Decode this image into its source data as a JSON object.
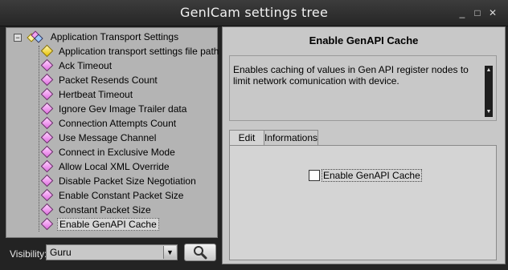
{
  "window": {
    "title": "GenICam settings tree",
    "controls": [
      "_",
      "□",
      "✕"
    ]
  },
  "tree": {
    "root": "Application Transport Settings",
    "items": [
      {
        "label": "Application transport settings file path",
        "icon": "yellow"
      },
      {
        "label": "Ack Timeout",
        "icon": "pink"
      },
      {
        "label": "Packet Resends Count",
        "icon": "pink"
      },
      {
        "label": "Hertbeat Timeout",
        "icon": "pink"
      },
      {
        "label": "Ignore Gev Image Trailer data",
        "icon": "pink"
      },
      {
        "label": "Connection Attempts Count",
        "icon": "pink"
      },
      {
        "label": "Use Message Channel",
        "icon": "pink"
      },
      {
        "label": "Connect in Exclusive Mode",
        "icon": "pink"
      },
      {
        "label": "Allow Local XML Override",
        "icon": "pink"
      },
      {
        "label": "Disable Packet Size Negotiation",
        "icon": "pink"
      },
      {
        "label": "Enable Constant Packet Size",
        "icon": "pink"
      },
      {
        "label": "Constant Packet Size",
        "icon": "pink"
      },
      {
        "label": "Enable GenAPI Cache",
        "icon": "pink",
        "selected": true
      }
    ]
  },
  "visibility": {
    "label": "Visibility:",
    "value": "Guru"
  },
  "details": {
    "title": "Enable GenAPI Cache",
    "description": "Enables caching of values in Gen API register nodes to limit network comunication with device.",
    "tabs": [
      "Edit",
      "Informations"
    ],
    "active_tab": "Edit",
    "checkbox_label": "Enable GenAPI Cache",
    "checked": false
  }
}
